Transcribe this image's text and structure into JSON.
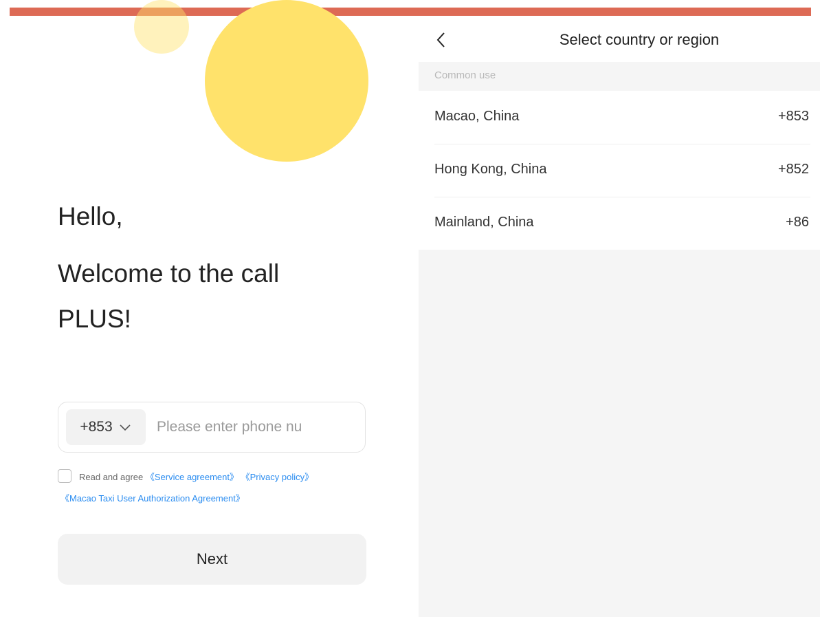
{
  "colors": {
    "top_bar": "#DD6A55",
    "circle_yellow": "#FFE26B",
    "link_blue": "#2A8CF0"
  },
  "login": {
    "greeting_line1": "Hello,",
    "greeting_line2": "Welcome to the call",
    "greeting_line3": "PLUS!",
    "country_code": "+853",
    "country_code_icon": "chevron-down-icon",
    "phone_placeholder": "Please enter phone nu",
    "phone_value": "",
    "agree_checked": false,
    "agree_text": "Read and agree",
    "service_link": "《Service agreement》",
    "privacy_link": "《Privacy policy》",
    "authorization_link": "《Macao Taxi User Authorization Agreement》",
    "next_label": "Next"
  },
  "region_select": {
    "back_icon": "chevron-left-icon",
    "title": "Select country or region",
    "section_label": "Common use",
    "countries": [
      {
        "name": "Macao, China",
        "code": "+853"
      },
      {
        "name": "Hong Kong, China",
        "code": "+852"
      },
      {
        "name": "Mainland, China",
        "code": "+86"
      }
    ]
  }
}
